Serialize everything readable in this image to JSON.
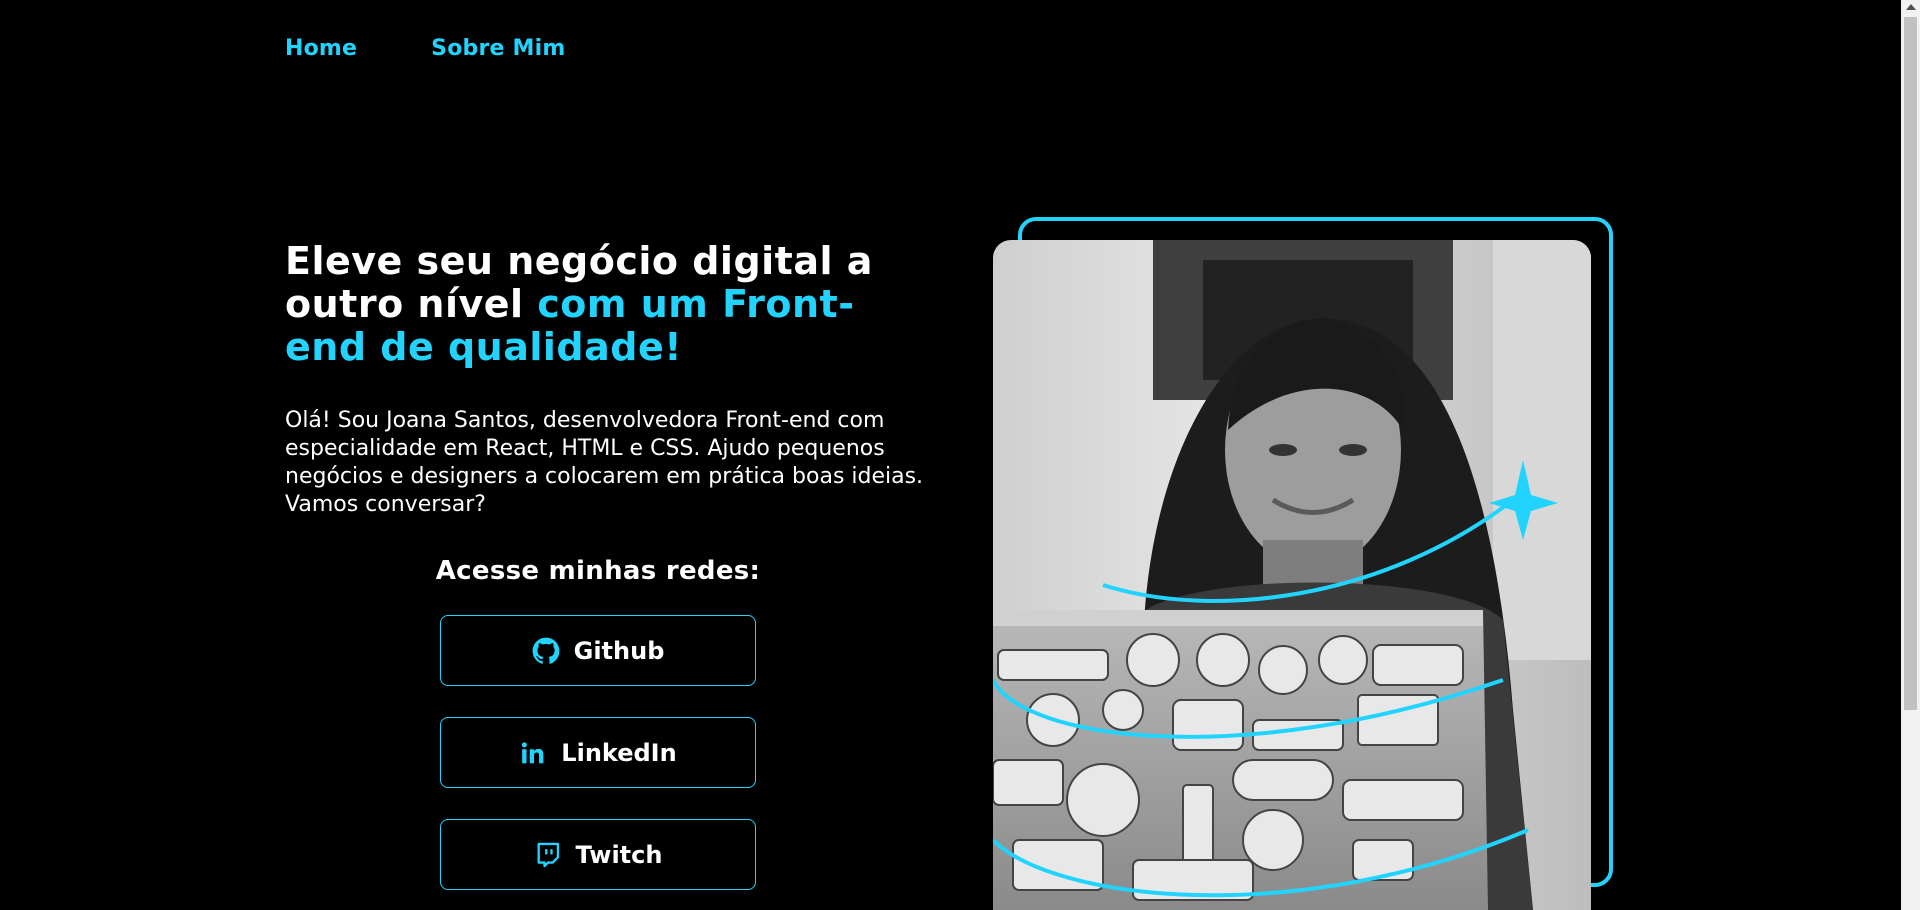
{
  "nav": {
    "items": [
      {
        "label": "Home"
      },
      {
        "label": "Sobre Mim"
      }
    ]
  },
  "hero": {
    "title_white": "Eleve seu negócio digital a outro nível",
    "title_accent": "com um Front-end de qualidade!",
    "intro": "Olá! Sou Joana Santos, desenvolvedora Front-end com especialidade em React, HTML e CSS. Ajudo pequenos negócios e designers a colocarem em prática boas ideias. Vamos conversar?",
    "social_heading": "Acesse minhas redes:",
    "social_links": [
      {
        "label": "Github",
        "icon": "github-icon"
      },
      {
        "label": "LinkedIn",
        "icon": "linkedin-icon"
      },
      {
        "label": "Twitch",
        "icon": "twitch-icon"
      }
    ]
  },
  "colors": {
    "background": "#000000",
    "accent": "#22d4fd",
    "text": "#ffffff"
  }
}
